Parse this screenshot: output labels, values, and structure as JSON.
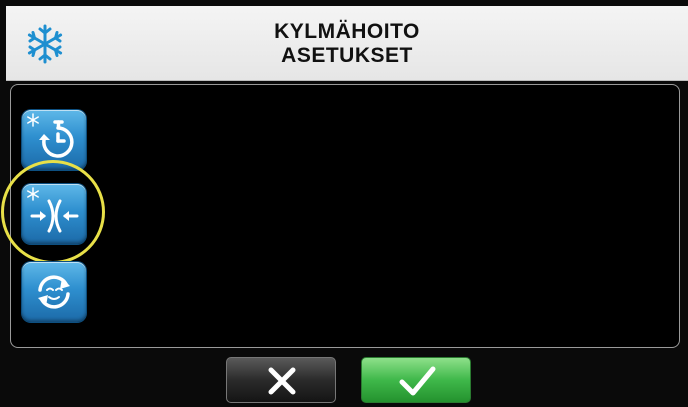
{
  "header": {
    "icon": "snowflake-icon",
    "title_line1": "KYLMÄHOITO",
    "title_line2": "ASETUKSET"
  },
  "side_buttons": [
    {
      "icon": "cold-timer-icon",
      "highlighted": false
    },
    {
      "icon": "cold-compression-icon",
      "highlighted": true
    },
    {
      "icon": "cycle-mode-icon",
      "highlighted": false
    }
  ],
  "actions": {
    "cancel_icon": "close-icon",
    "confirm_icon": "checkmark-icon"
  },
  "colors": {
    "header_bg": "#f0f0f0",
    "accent_blue": "#2e8fcf",
    "highlight": "#e8e048",
    "confirm_green": "#3fb84a"
  }
}
